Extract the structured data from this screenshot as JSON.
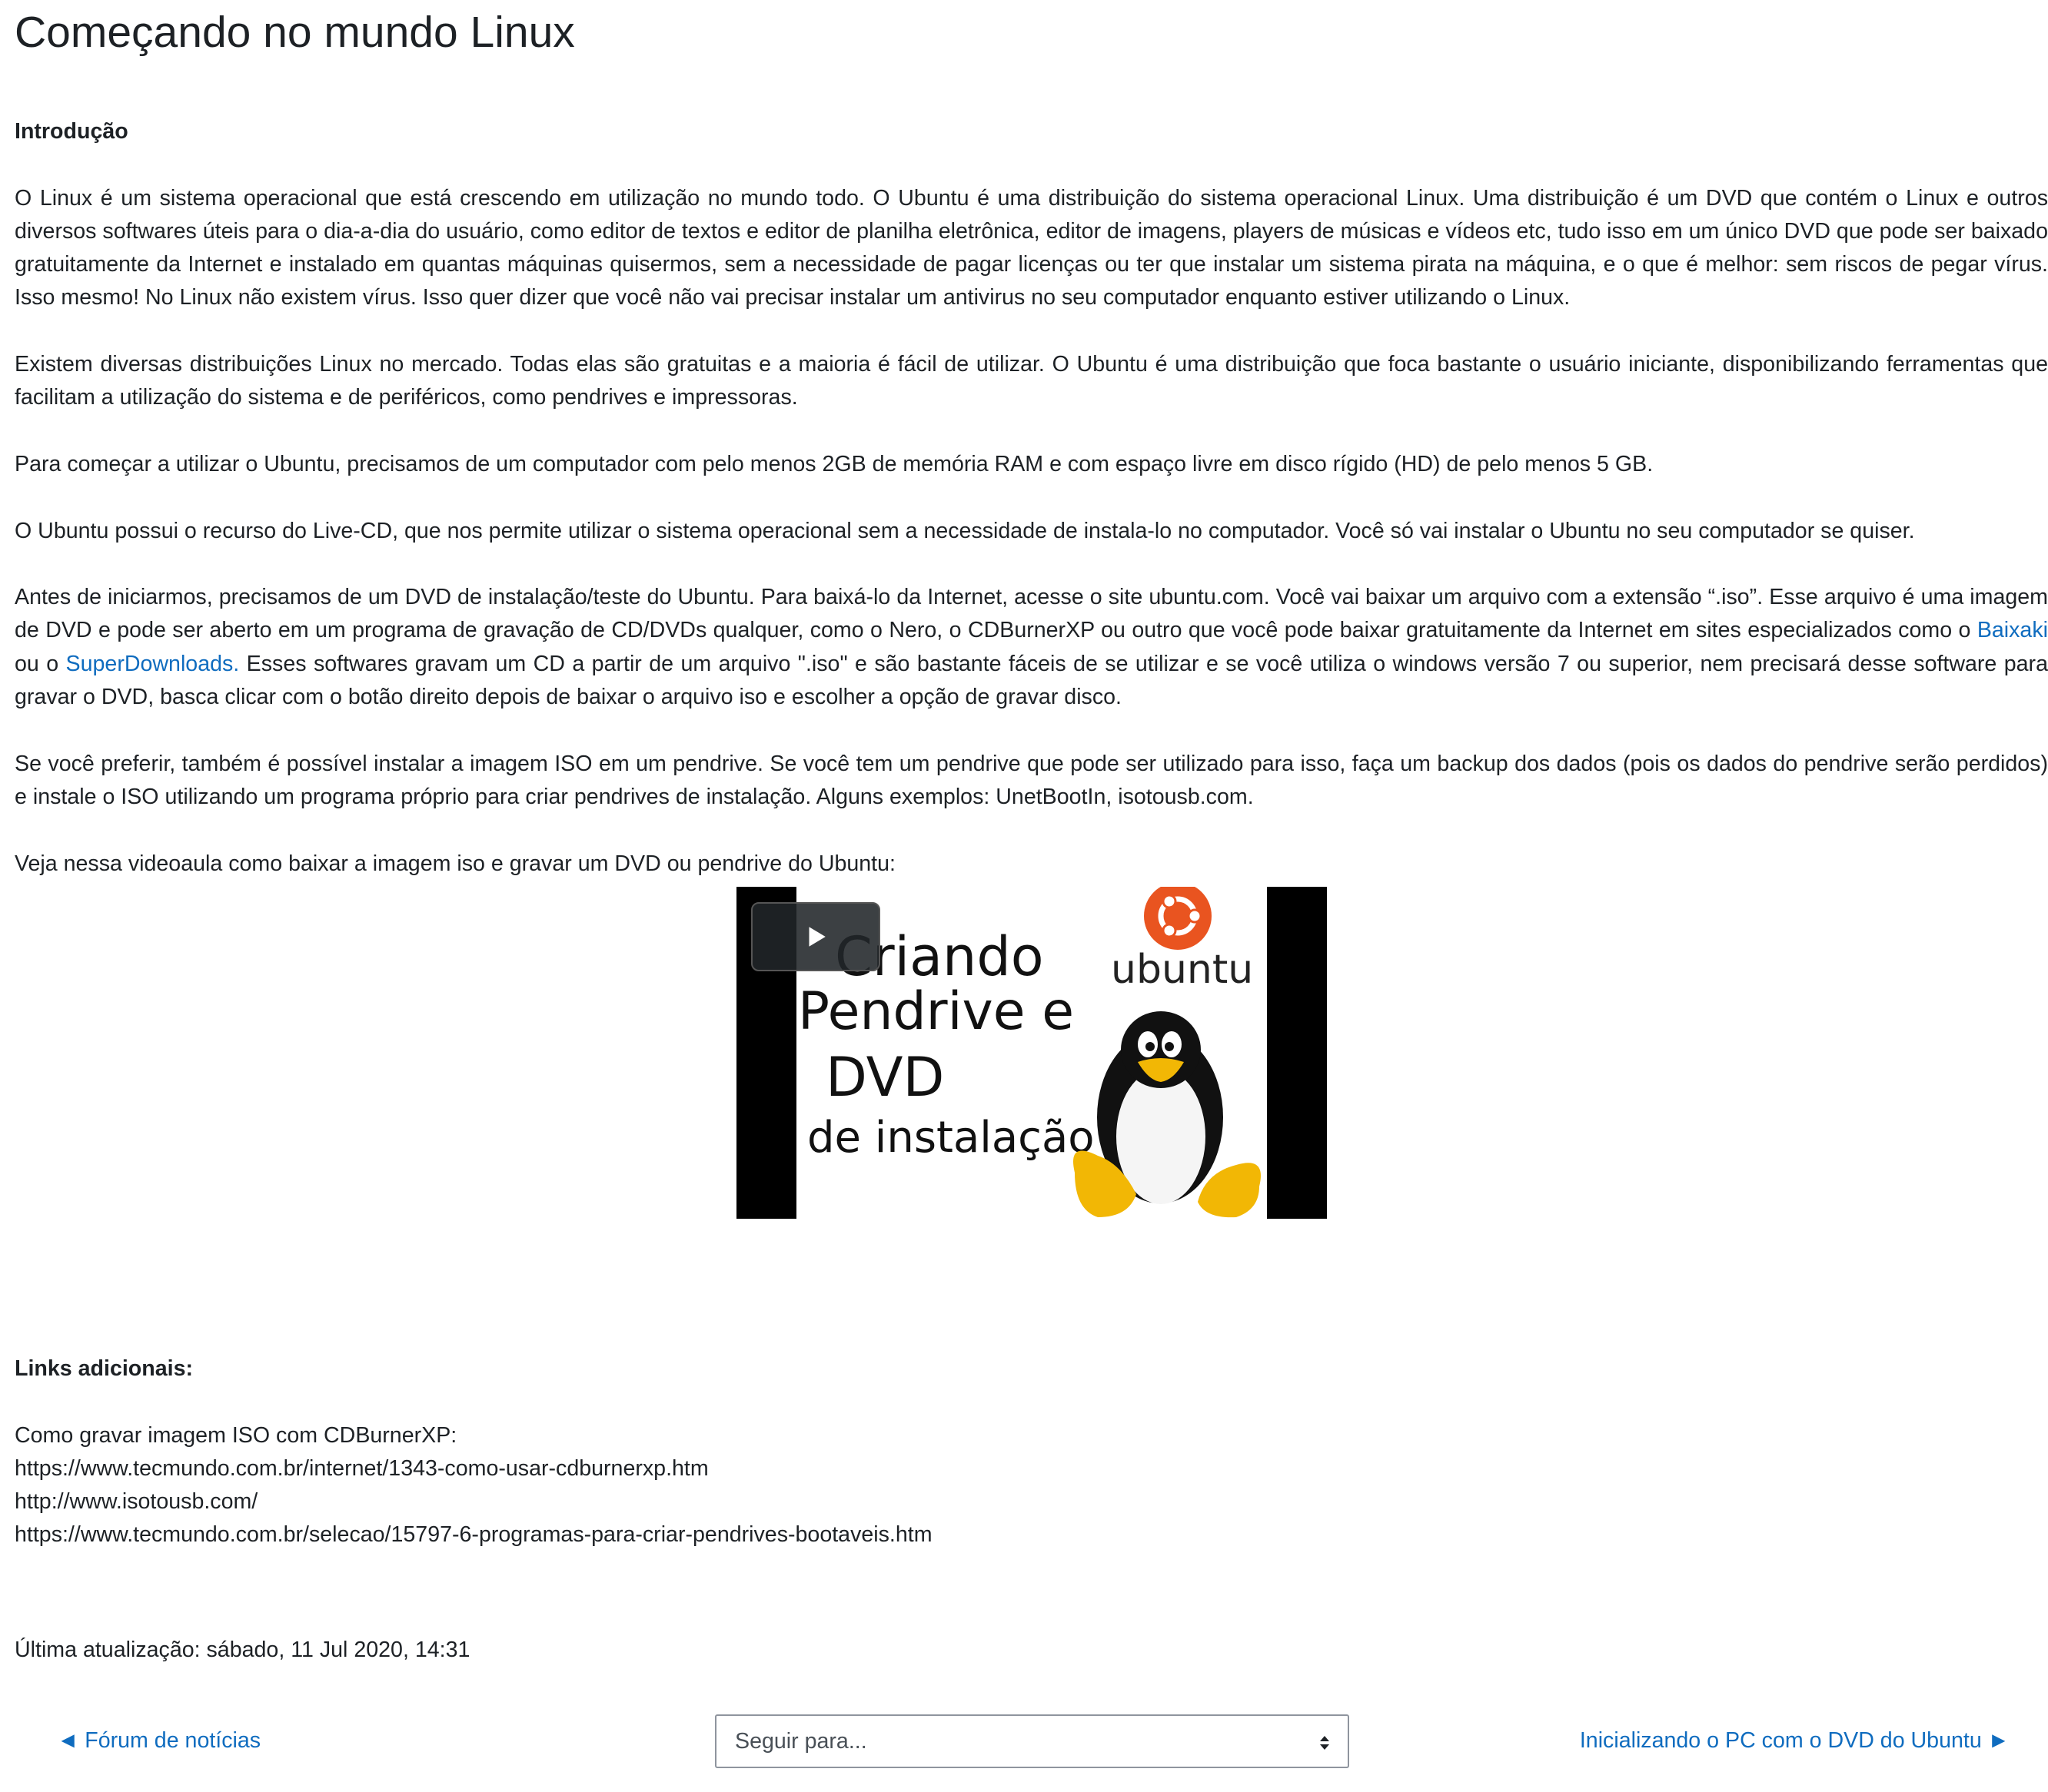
{
  "page": {
    "title": "Começando no mundo Linux"
  },
  "intro": {
    "heading": "Introdução",
    "p1": "O Linux é um sistema operacional que está crescendo em utilização no mundo todo. O Ubuntu é uma distribuição do sistema operacional Linux. Uma distribuição é um DVD que contém o Linux e outros diversos softwares úteis para o dia-a-dia do usuário, como editor de textos e editor de planilha eletrônica, editor de imagens, players de músicas e vídeos etc, tudo isso em um único DVD que pode ser baixado gratuitamente da Internet e instalado em quantas máquinas quisermos, sem a necessidade de pagar licenças ou ter que instalar um sistema pirata na máquina, e o que é melhor: sem riscos de pegar vírus. Isso mesmo! No Linux não existem vírus. Isso quer dizer que você não vai precisar instalar um antivirus no seu computador enquanto estiver utilizando o Linux.",
    "p2": "Existem diversas distribuições Linux no mercado. Todas elas são gratuitas e a maioria é fácil de utilizar. O Ubuntu é uma distribuição que foca bastante o usuário iniciante, disponibilizando ferramentas que facilitam a utilização do sistema e de periféricos, como pendrives e impressoras.",
    "p3": "Para começar a utilizar o Ubuntu, precisamos de um computador com pelo menos 2GB de memória RAM e com espaço livre em disco rígido (HD) de pelo menos 5 GB.",
    "p4": "O Ubuntu possui o recurso do Live-CD, que nos permite utilizar o sistema operacional sem a necessidade de instala-lo no computador. Você só vai instalar o Ubuntu no seu computador se quiser.",
    "p5_before": "Antes de iniciarmos, precisamos de um DVD de instalação/teste do Ubuntu. Para baixá-lo da Internet, acesse o site ubuntu.com. Você vai baixar um arquivo com a extensão “.iso”. Esse arquivo é uma imagem de DVD e pode ser aberto em um programa de gravação de CD/DVDs qualquer, como o Nero, o CDBurnerXP ou outro que você pode baixar gratuitamente da Internet em sites especializados como o ",
    "p5_link1": "Baixaki",
    "p5_mid": " ou o ",
    "p5_link2": "SuperDownloads.",
    "p5_after": " Esses softwares gravam um CD a partir de um arquivo \".iso\" e são bastante fáceis de se utilizar e se você utiliza o windows versão 7 ou superior, nem precisará desse software para gravar o DVD, basca clicar com o botão direito depois de baixar o arquivo iso e escolher a opção de gravar disco.",
    "p6": "Se você preferir, também é possível instalar a imagem ISO em um pendrive. Se você tem um pendrive que pode ser utilizado para isso, faça um backup dos dados (pois os dados do pendrive serão perdidos) e instale o ISO utilizando um programa próprio para criar pendrives de instalação. Alguns exemplos: UnetBootIn, isotousb.com.",
    "p7": "Veja nessa videoaula como baixar a imagem iso e gravar um DVD ou pendrive do Ubuntu:"
  },
  "video": {
    "line1": "Criando",
    "line2": "Pendrive e",
    "line3": "DVD",
    "line4": "de instalação",
    "brand": "ubuntu",
    "play_icon": "play-icon",
    "colors": {
      "ubuntu_orange": "#e95420",
      "background": "#000000"
    }
  },
  "links": {
    "heading": "Links adicionais:",
    "label": "Como gravar imagem ISO com CDBurnerXP:",
    "url1": "https://www.tecmundo.com.br/internet/1343-como-usar-cdburnerxp.htm",
    "url2": "http://www.isotousb.com/",
    "url3": "https://www.tecmundo.com.br/selecao/15797-6-programas-para-criar-pendrives-bootaveis.htm"
  },
  "footer": {
    "last_updated": "Última atualização: sábado, 11 Jul 2020, 14:31",
    "prev_label": "◄ Fórum de notícias",
    "jump_placeholder": "Seguir para...",
    "next_label": "Inicializando o PC com o DVD do Ubuntu ►",
    "link_color": "#0f6cbf"
  }
}
